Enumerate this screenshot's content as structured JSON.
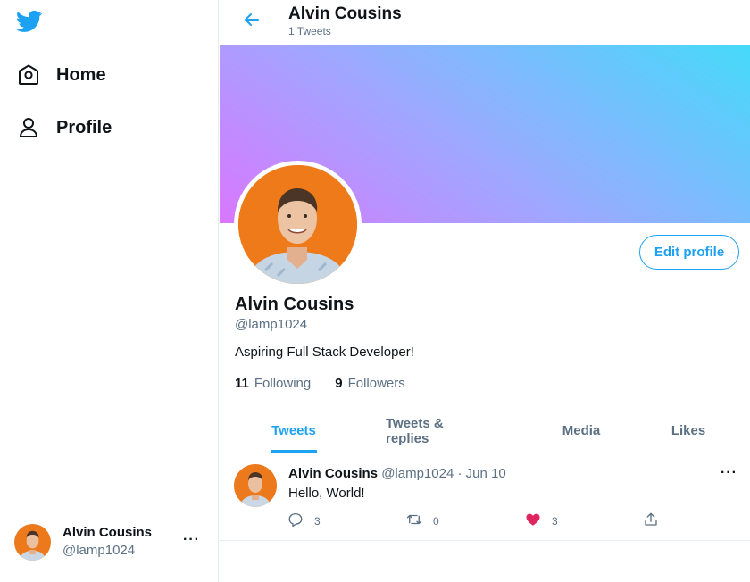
{
  "sidebar": {
    "logo_icon": "twitter-bird-icon",
    "nav": [
      {
        "label": "Home",
        "icon": "home-icon"
      },
      {
        "label": "Profile",
        "icon": "user-icon"
      }
    ],
    "account": {
      "name": "Alvin Cousins",
      "handle": "@lamp1024",
      "more": "···"
    }
  },
  "header": {
    "title": "Alvin Cousins",
    "subtitle": "1 Tweets",
    "back_icon": "arrow-left-icon"
  },
  "profile": {
    "name": "Alvin Cousins",
    "handle": "@lamp1024",
    "bio": "Aspiring Full Stack Developer!",
    "following_count": "11",
    "following_label": "Following",
    "followers_count": "9",
    "followers_label": "Followers",
    "edit_button": "Edit profile"
  },
  "tabs": [
    {
      "label": "Tweets",
      "active": true
    },
    {
      "label": "Tweets & replies",
      "active": false
    },
    {
      "label": "Media",
      "active": false
    },
    {
      "label": "Likes",
      "active": false
    }
  ],
  "tweets": [
    {
      "name": "Alvin Cousins",
      "handle": "@lamp1024",
      "separator": "·",
      "date": "Jun 10",
      "text": "Hello, World!",
      "more": "···",
      "replies": "3",
      "retweets": "0",
      "likes": "3",
      "liked": true
    }
  ],
  "colors": {
    "accent": "#1da1f2",
    "like": "#e0245e",
    "muted": "#5b7083",
    "banner_gradient": [
      "#d977ff",
      "#9ea8ff",
      "#45dafa"
    ]
  }
}
